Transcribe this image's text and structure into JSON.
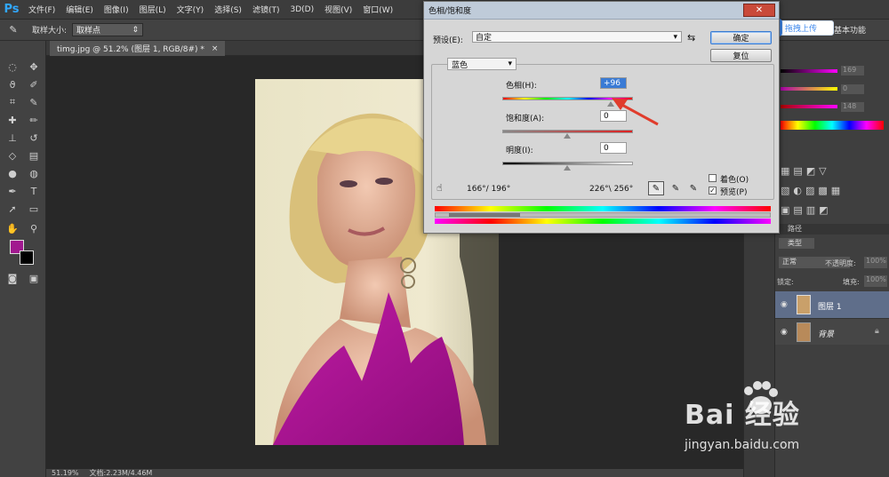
{
  "menubar": {
    "logo": "Ps",
    "items": [
      "文件(F)",
      "编辑(E)",
      "图像(I)",
      "图层(L)",
      "文字(Y)",
      "选择(S)",
      "滤镜(T)",
      "3D(D)",
      "视图(V)",
      "窗口(W)"
    ]
  },
  "options": {
    "sample_label": "取样大小:",
    "sample_value": "取样点",
    "workspace": "基本功能"
  },
  "document": {
    "tab_label": "timg.jpg @ 51.2% (图层 1, RGB/8#) *",
    "zoom": "51.19%",
    "doc_info": "文档:2.23M/4.46M"
  },
  "upload": {
    "label": "拖拽上传"
  },
  "dialog": {
    "title": "色相/饱和度",
    "preset_label": "预设(E):",
    "preset_value": "自定",
    "ok_label": "确定",
    "reset_label": "复位",
    "channel": "蓝色",
    "hue_label": "色相(H):",
    "hue_value": "+96",
    "saturation_label": "饱和度(A):",
    "saturation_value": "0",
    "lightness_label": "明度(I):",
    "lightness_value": "0",
    "range_left": "166°/ 196°",
    "range_right": "226°\\ 256°",
    "colorize_label": "着色(O)",
    "colorize_checked": false,
    "preview_label": "预览(P)",
    "preview_checked": true
  },
  "right_panel": {
    "color_values": [
      "169",
      "0",
      "148"
    ],
    "layers_tab": "路径",
    "filter_kind": "类型",
    "blend_mode": "正常",
    "opacity_label": "不透明度:",
    "opacity_value": "100%",
    "lock_label": "锁定:",
    "fill_label": "填充:",
    "fill_value": "100%",
    "layers": [
      {
        "name": "图层 1",
        "selected": true
      },
      {
        "name": "背景",
        "selected": false
      }
    ]
  },
  "watermark": {
    "brand": "Bai  经验",
    "url": "jingyan.baidu.com"
  }
}
